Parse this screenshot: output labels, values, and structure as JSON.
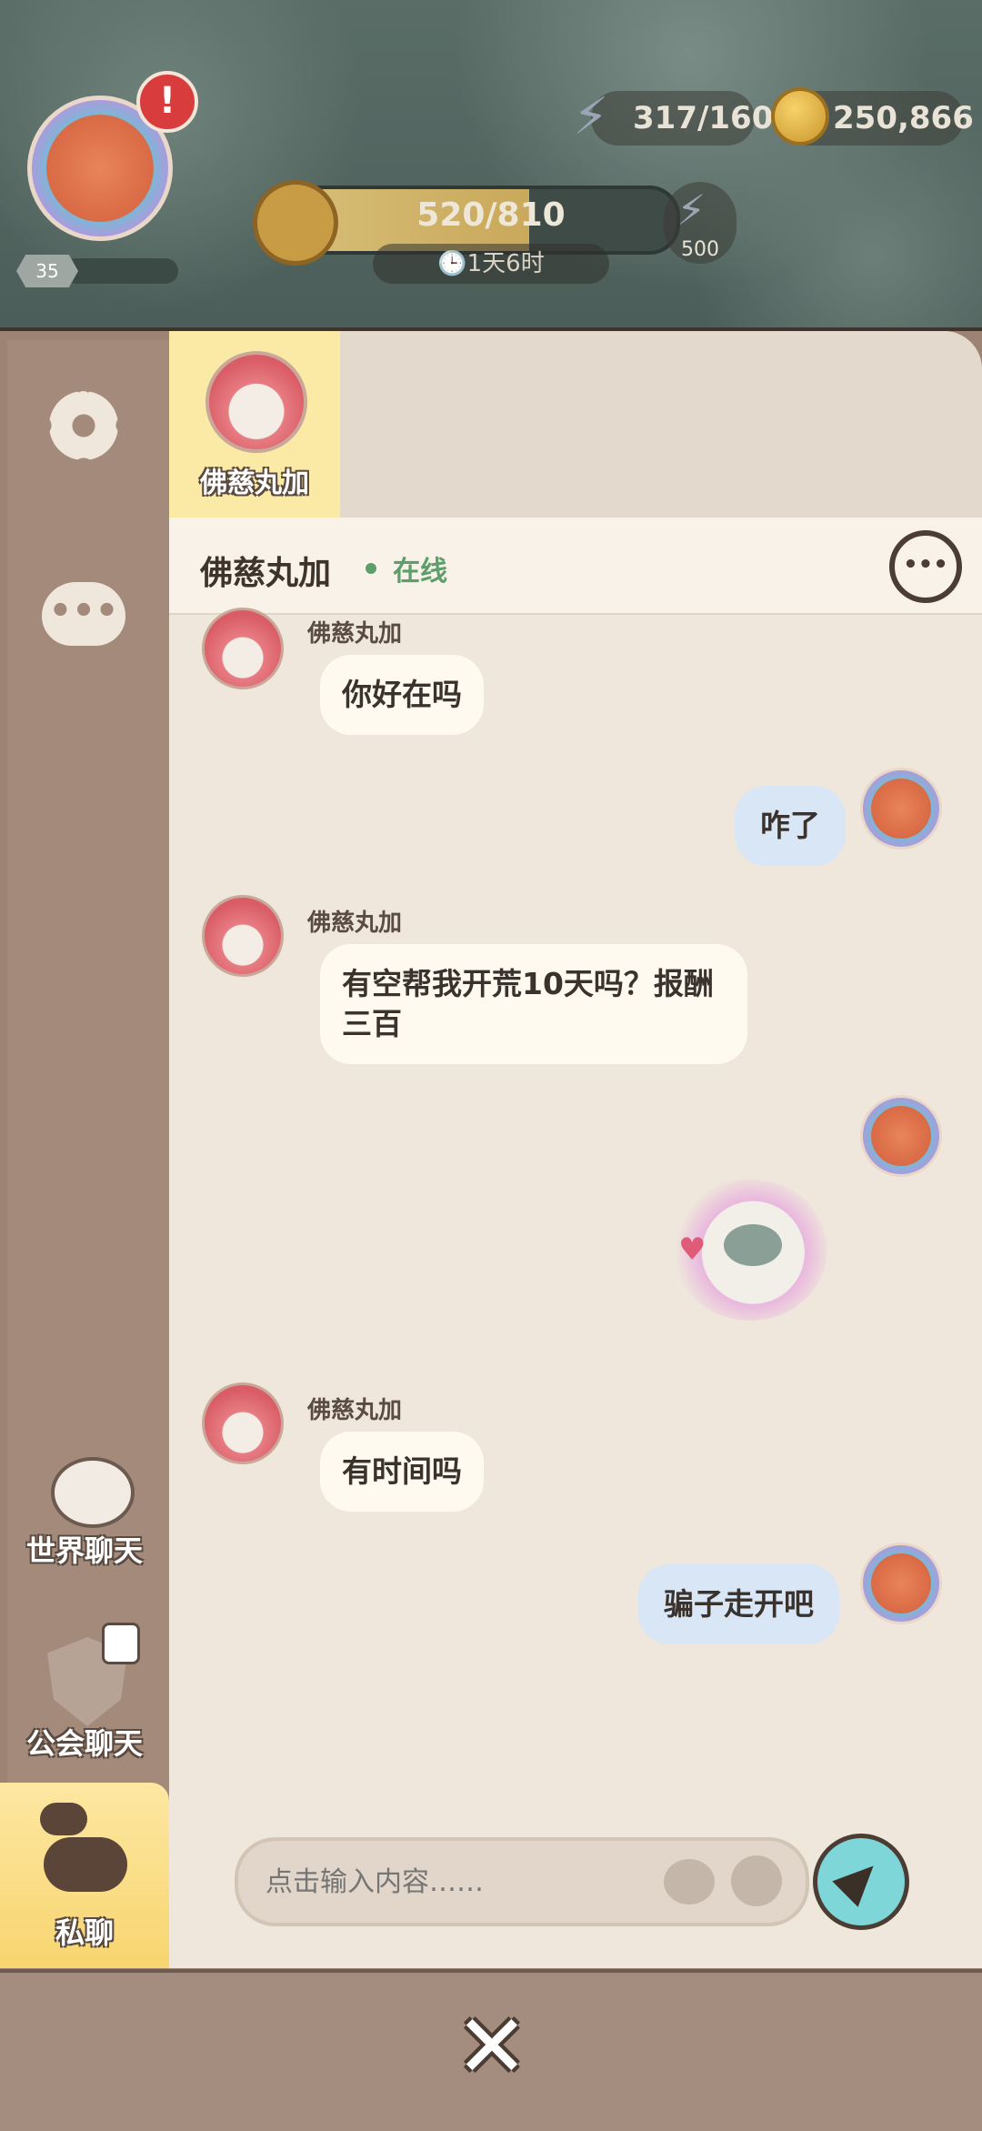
{
  "hud": {
    "level": "35",
    "energy": "317/160",
    "coins": "250,866",
    "progress": "520/810",
    "progress_fraction": 0.64,
    "timer": "1天6时",
    "bonus": "500"
  },
  "friends": [
    {
      "name": "佛慈丸加"
    }
  ],
  "chat": {
    "title": "佛慈丸加",
    "status": "在线",
    "messages": [
      {
        "from": "佛慈丸加",
        "side": "in",
        "text": "你好在吗"
      },
      {
        "side": "out",
        "text": "咋了"
      },
      {
        "from": "佛慈丸加",
        "side": "in",
        "text": "有空帮我开荒10天吗？报酬三百"
      },
      {
        "side": "out",
        "sticker": "cat-hearts-sticker"
      },
      {
        "from": "佛慈丸加",
        "side": "in",
        "text": "有时间吗"
      },
      {
        "side": "out",
        "text": "骗子走开吧"
      }
    ],
    "input_placeholder": "点击输入内容……"
  },
  "sidebar": {
    "world_chat": "世界聊天",
    "guild_chat": "公会聊天",
    "private_chat": "私聊"
  },
  "colors": {
    "accent_yellow": "#fbeaa6",
    "send_button": "#7fd6d9",
    "online_green": "#5e9e6a"
  }
}
